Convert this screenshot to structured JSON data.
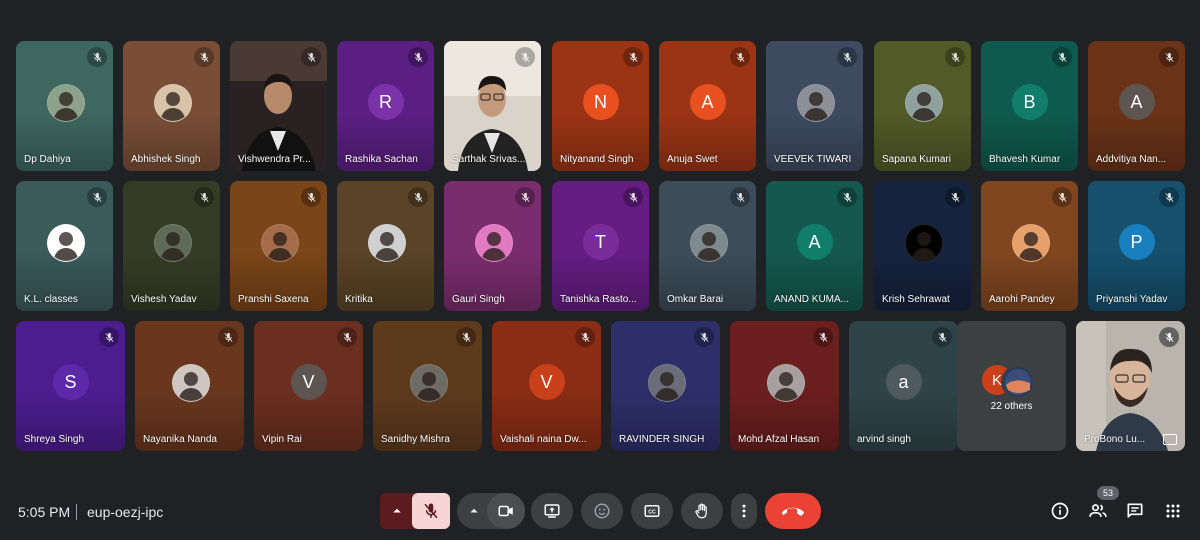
{
  "participants_row1": [
    {
      "name": "Dp Dahiya",
      "bg": "#3e6760",
      "kind": "photo",
      "av": "#8da28a"
    },
    {
      "name": "Abhishek Singh",
      "bg": "#7a4e36",
      "kind": "photo",
      "av": "#d8c2a8"
    },
    {
      "name": "Vishwendra Pr...",
      "bg": "#2b2424",
      "kind": "video"
    },
    {
      "name": "Rashika Sachan",
      "bg": "#5b1f83",
      "kind": "letter",
      "letter": "R",
      "av": "#7b32a8"
    },
    {
      "name": "Sarthak Srivas...",
      "bg": "#605c55",
      "kind": "video"
    },
    {
      "name": "Nityanand Singh",
      "bg": "#9b3414",
      "kind": "letter",
      "letter": "N",
      "av": "#e8501f"
    },
    {
      "name": "Anuja Swet",
      "bg": "#9b3414",
      "kind": "letter",
      "letter": "A",
      "av": "#e8501f"
    },
    {
      "name": "VEEVEK TIWARI",
      "bg": "#3d4a60",
      "kind": "photo",
      "av": "#8a8f98"
    },
    {
      "name": "Sapana Kumari",
      "bg": "#525a28",
      "kind": "photo",
      "av": "#8fa2a0"
    },
    {
      "name": "Bhavesh Kumar",
      "bg": "#0f5a4e",
      "kind": "letter",
      "letter": "B",
      "av": "#117e6c"
    },
    {
      "name": "Addvitiya Nan...",
      "bg": "#6a3318",
      "kind": "letter",
      "letter": "A",
      "av": "#5f5550"
    }
  ],
  "participants_row2": [
    {
      "name": "K.L. classes",
      "bg": "#3b5a5b",
      "kind": "photo",
      "av": "#ffffff"
    },
    {
      "name": "Vishesh Yadav",
      "bg": "#343c26",
      "kind": "photo",
      "av": "#5d6b58"
    },
    {
      "name": "Pranshi Saxena",
      "bg": "#7a4518",
      "kind": "photo",
      "av": "#a56c4a"
    },
    {
      "name": "Kritika",
      "bg": "#5a4326",
      "kind": "photo",
      "av": "#d0d0d0"
    },
    {
      "name": "Gauri Singh",
      "bg": "#7a2d6e",
      "kind": "photo",
      "av": "#e27ac1"
    },
    {
      "name": "Tanishka Rasto...",
      "bg": "#651d82",
      "kind": "letter",
      "letter": "T",
      "av": "#7a2b9a"
    },
    {
      "name": "Omkar Barai",
      "bg": "#3c4c58",
      "kind": "photo",
      "av": "#7d8a8f"
    },
    {
      "name": "ANAND KUMA...",
      "bg": "#14584f",
      "kind": "letter",
      "letter": "A",
      "av": "#117e6c"
    },
    {
      "name": "Krish Sehrawat",
      "bg": "#16233e",
      "kind": "photo",
      "av": "#000000"
    },
    {
      "name": "Aarohi Pandey",
      "bg": "#80461f",
      "kind": "photo",
      "av": "#e8a06a"
    },
    {
      "name": "Priyanshi Yadav",
      "bg": "#16506d",
      "kind": "letter",
      "letter": "P",
      "av": "#1a7fbf"
    }
  ],
  "participants_row3": [
    {
      "name": "Shreya Singh",
      "bg": "#4c1d8f",
      "kind": "letter",
      "letter": "S",
      "av": "#5c2aa8"
    },
    {
      "name": "Nayanika Nanda",
      "bg": "#6a361e",
      "kind": "photo",
      "av": "#cfc6c0"
    },
    {
      "name": "Vipin Rai",
      "bg": "#6b2f20",
      "kind": "letter",
      "letter": "V",
      "av": "#5f5550"
    },
    {
      "name": "Sanidhy Mishra",
      "bg": "#5e3a1d",
      "kind": "photo",
      "av": "#6e6a64"
    },
    {
      "name": "Vaishali naina Dw...",
      "bg": "#8a2d14",
      "kind": "letter",
      "letter": "V",
      "av": "#c9401a"
    },
    {
      "name": "RAVINDER SINGH",
      "bg": "#2d2f6a",
      "kind": "photo",
      "av": "#6a6c78"
    },
    {
      "name": "Mohd Afzal Hasan",
      "bg": "#6b1f1e",
      "kind": "photo",
      "av": "#a8a0a0"
    },
    {
      "name": "arvind singh",
      "bg": "#2f4448",
      "kind": "letter",
      "letter": "a",
      "av": "#4e5a5c"
    }
  ],
  "others": {
    "letter": "K",
    "label": "22 others"
  },
  "self_tile": {
    "name": "ProBono Lu..."
  },
  "bar": {
    "time": "5:05 PM",
    "meeting_code": "eup-oezj-ipc",
    "participant_count": "53"
  }
}
